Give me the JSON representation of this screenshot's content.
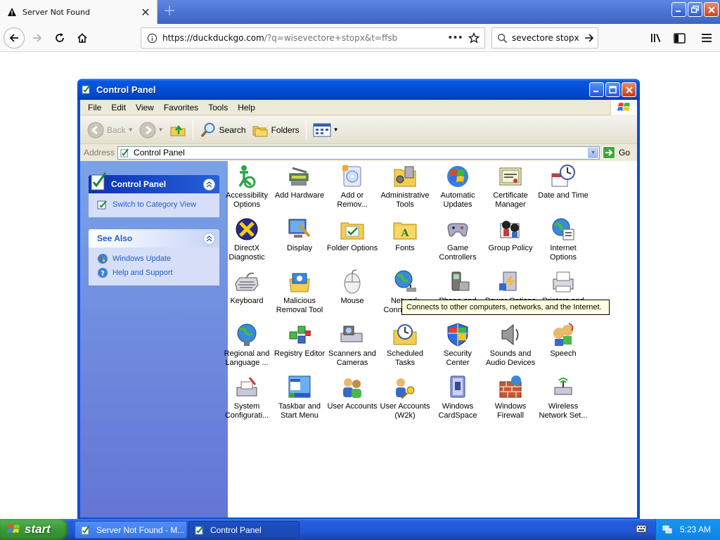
{
  "browser": {
    "tab_title": "Server Not Found",
    "url_host": "https://duckduckgo.com",
    "url_rest": "/?q=wisevectore+stopx&t=ffsb",
    "search_query": "sevectore stopx"
  },
  "window": {
    "title": "Control Panel",
    "menu": [
      "File",
      "Edit",
      "View",
      "Favorites",
      "Tools",
      "Help"
    ],
    "toolbar": {
      "back": "Back",
      "search": "Search",
      "folders": "Folders"
    },
    "address_label": "Address",
    "address_value": "Control Panel",
    "go_label": "Go"
  },
  "sidebar": {
    "control_panel_title": "Control Panel",
    "switch_view": "Switch to Category View",
    "see_also_title": "See Also",
    "see_also_links": [
      "Windows Update",
      "Help and Support"
    ]
  },
  "items": [
    {
      "label": "Accessibility Options",
      "icon": "accessibility-icon"
    },
    {
      "label": "Add Hardware",
      "icon": "add-hardware-icon"
    },
    {
      "label": "Add or Remov...",
      "icon": "add-remove-programs-icon"
    },
    {
      "label": "Administrative Tools",
      "icon": "admin-tools-icon"
    },
    {
      "label": "Automatic Updates",
      "icon": "windows-logo-icon"
    },
    {
      "label": "Certificate Manager",
      "icon": "certificate-icon"
    },
    {
      "label": "Date and Time",
      "icon": "clock-icon"
    },
    {
      "label": "DirectX Diagnostic",
      "icon": "directx-icon"
    },
    {
      "label": "Display",
      "icon": "display-icon"
    },
    {
      "label": "Folder Options",
      "icon": "folder-options-icon"
    },
    {
      "label": "Fonts",
      "icon": "fonts-folder-icon"
    },
    {
      "label": "Game Controllers",
      "icon": "gamepad-icon"
    },
    {
      "label": "Group Policy",
      "icon": "group-policy-icon"
    },
    {
      "label": "Internet Options",
      "icon": "internet-options-icon"
    },
    {
      "label": "Keyboard",
      "icon": "keyboard-icon"
    },
    {
      "label": "Malicious Removal Tool",
      "icon": "malicious-removal-icon"
    },
    {
      "label": "Mouse",
      "icon": "mouse-icon"
    },
    {
      "label": "Network Connections",
      "icon": "network-globe-icon"
    },
    {
      "label": "Phone and Modem",
      "icon": "phone-icon"
    },
    {
      "label": "Power Options",
      "icon": "power-icon"
    },
    {
      "label": "Printers and Faxes",
      "icon": "printer-icon"
    },
    {
      "label": "Regional and Language ...",
      "icon": "globe-icon"
    },
    {
      "label": "Registry Editor",
      "icon": "registry-icon"
    },
    {
      "label": "Scanners and Cameras",
      "icon": "scanner-icon"
    },
    {
      "label": "Scheduled Tasks",
      "icon": "scheduled-tasks-icon"
    },
    {
      "label": "Security Center",
      "icon": "shield-icon"
    },
    {
      "label": "Sounds and Audio Devices",
      "icon": "speaker-icon"
    },
    {
      "label": "Speech",
      "icon": "speech-icon"
    },
    {
      "label": "System Configurati...",
      "icon": "system-config-icon"
    },
    {
      "label": "Taskbar and Start Menu",
      "icon": "taskbar-icon"
    },
    {
      "label": "User Accounts",
      "icon": "users-icon"
    },
    {
      "label": "User Accounts (W2k)",
      "icon": "users-key-icon"
    },
    {
      "label": "Windows CardSpace",
      "icon": "cardspace-icon"
    },
    {
      "label": "Windows Firewall",
      "icon": "firewall-icon"
    },
    {
      "label": "Wireless Network Set...",
      "icon": "wireless-icon"
    }
  ],
  "tooltip": "Connects to other computers, networks, and the Internet.",
  "taskbar": {
    "start": "start",
    "tasks": [
      "Server Not Found - M...",
      "Control Panel"
    ],
    "clock": "5:23 AM"
  }
}
